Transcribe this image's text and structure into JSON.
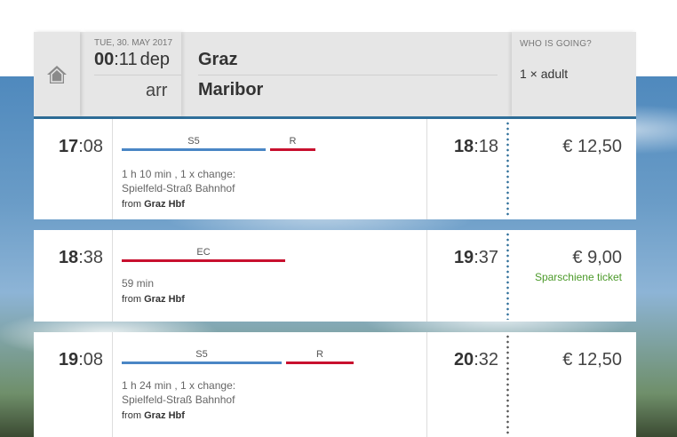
{
  "search": {
    "date_label": "TUE, 30. MAY 2017",
    "dep_hour": "00",
    "dep_minute": ":11",
    "dep_label": "dep",
    "arr_label": "arr",
    "from_station": "Graz",
    "to_station": "Maribor",
    "who_label": "WHO IS GOING?",
    "who_value": "1 × adult"
  },
  "connections": [
    {
      "dep_hour": "17",
      "dep_minute": ":08",
      "arr_hour": "18",
      "arr_minute": ":18",
      "segments": [
        {
          "label": "S5",
          "type": "blue"
        },
        {
          "label": "R",
          "type": "red"
        }
      ],
      "duration": "1 h 10 min , 1 x change:",
      "via": "Spielfeld-Straß Bahnhof",
      "from_prefix": "from",
      "from_station": "Graz Hbf",
      "price": "€ 12,50",
      "tariff": ""
    },
    {
      "dep_hour": "18",
      "dep_minute": ":38",
      "arr_hour": "19",
      "arr_minute": ":37",
      "segments": [
        {
          "label": "EC",
          "type": "red"
        }
      ],
      "duration": "59 min",
      "via": "",
      "from_prefix": "from",
      "from_station": "Graz Hbf",
      "price": "€ 9,00",
      "tariff": "Sparschiene ticket"
    },
    {
      "dep_hour": "19",
      "dep_minute": ":08",
      "arr_hour": "20",
      "arr_minute": ":32",
      "segments": [
        {
          "label": "S5",
          "type": "blue"
        },
        {
          "label": "R",
          "type": "red"
        }
      ],
      "duration": "1 h 24 min , 1 x change:",
      "via": "Spielfeld-Straß Bahnhof",
      "from_prefix": "from",
      "from_station": "Graz Hbf",
      "price": "€ 12,50",
      "tariff": ""
    }
  ],
  "colors": {
    "accent": "#2f6f9a",
    "blue_segment": "#4a86c5",
    "red_segment": "#c8102e",
    "tariff_green": "#4c9a2a"
  },
  "icons": {
    "home": "home-icon"
  }
}
